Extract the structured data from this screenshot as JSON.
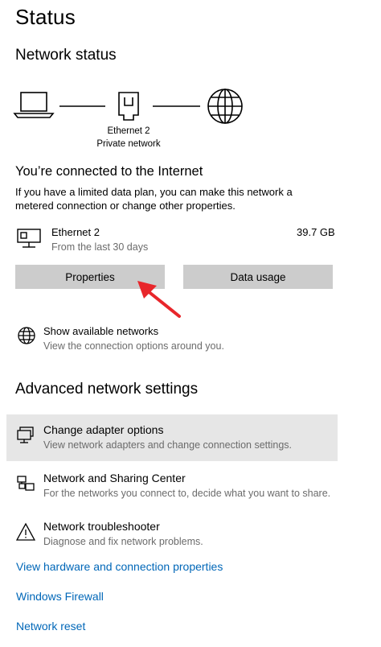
{
  "page_title": "Status",
  "network_status": {
    "heading": "Network status",
    "adapter_name": "Ethernet 2",
    "network_type": "Private network"
  },
  "connection": {
    "heading": "You’re connected to the Internet",
    "description_line1": "If you have a limited data plan, you can make this network a",
    "description_line2": "metered connection or change other properties.",
    "adapter_name": "Ethernet 2",
    "period": "From the last 30 days",
    "data_used": "39.7 GB"
  },
  "buttons": {
    "properties": "Properties",
    "data_usage": "Data usage"
  },
  "show_networks": {
    "title": "Show available networks",
    "description": "View the connection options around you."
  },
  "advanced": {
    "heading": "Advanced network settings",
    "items": [
      {
        "title": "Change adapter options",
        "description": "View network adapters and change connection settings.",
        "icon": "adapter-icon",
        "highlighted": true
      },
      {
        "title": "Network and Sharing Center",
        "description": "For the networks you connect to, decide what you want to share.",
        "icon": "sharing-center-icon",
        "highlighted": false
      },
      {
        "title": "Network troubleshooter",
        "description": "Diagnose and fix network problems.",
        "icon": "warning-icon",
        "highlighted": false
      }
    ]
  },
  "links": {
    "hardware": "View hardware and connection properties",
    "firewall": "Windows Firewall",
    "reset": "Network reset"
  },
  "colors": {
    "accent_link": "#0067b8",
    "button_bg": "#cccccc",
    "highlight_bg": "#e6e6e6",
    "annotation_arrow": "#e8262b"
  }
}
